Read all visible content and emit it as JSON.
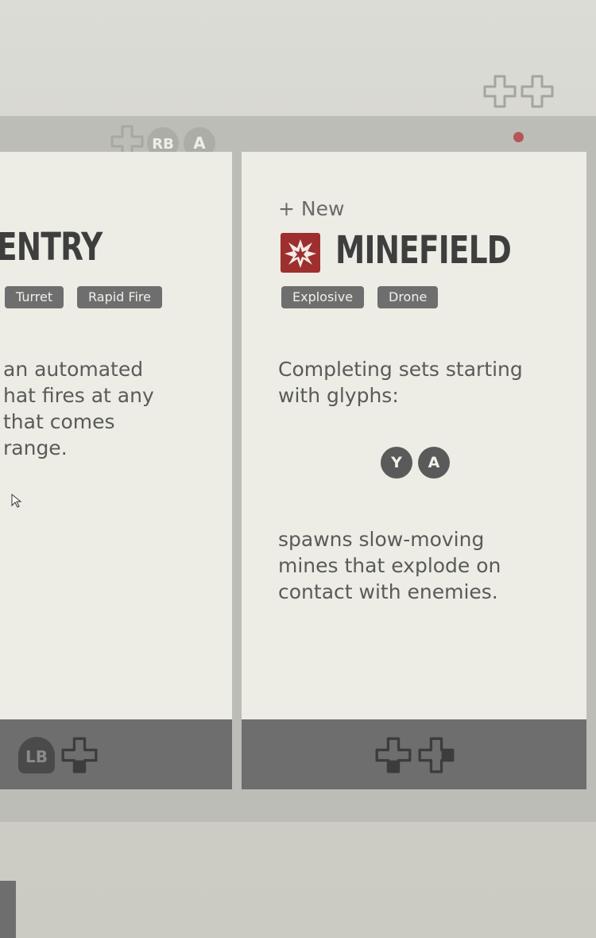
{
  "hud": {
    "rb_label": "RB",
    "a_label": "A",
    "lb_label": "LB"
  },
  "cards": {
    "left": {
      "title": "ENTRY",
      "tags": [
        "Turret",
        "Rapid Fire"
      ],
      "description": "an automated\nhat fires at any\nthat comes\nrange."
    },
    "right": {
      "new_label": "+ New",
      "title": "MINEFIELD",
      "tags": [
        "Explosive",
        "Drone"
      ],
      "description": "Completing sets starting\nwith glyphs:",
      "glyphs": [
        "Y",
        "A"
      ],
      "effect": "spawns slow-moving\nmines that explode on\ncontact with enemies."
    }
  },
  "colors": {
    "card_bg": "#edede6",
    "footer_bg": "#6e6e6e",
    "icon_red": "#9e2f2f",
    "indicator_dot": "#b35656"
  },
  "icons": [
    "dpad-icon",
    "explosion-icon",
    "cursor-icon"
  ]
}
